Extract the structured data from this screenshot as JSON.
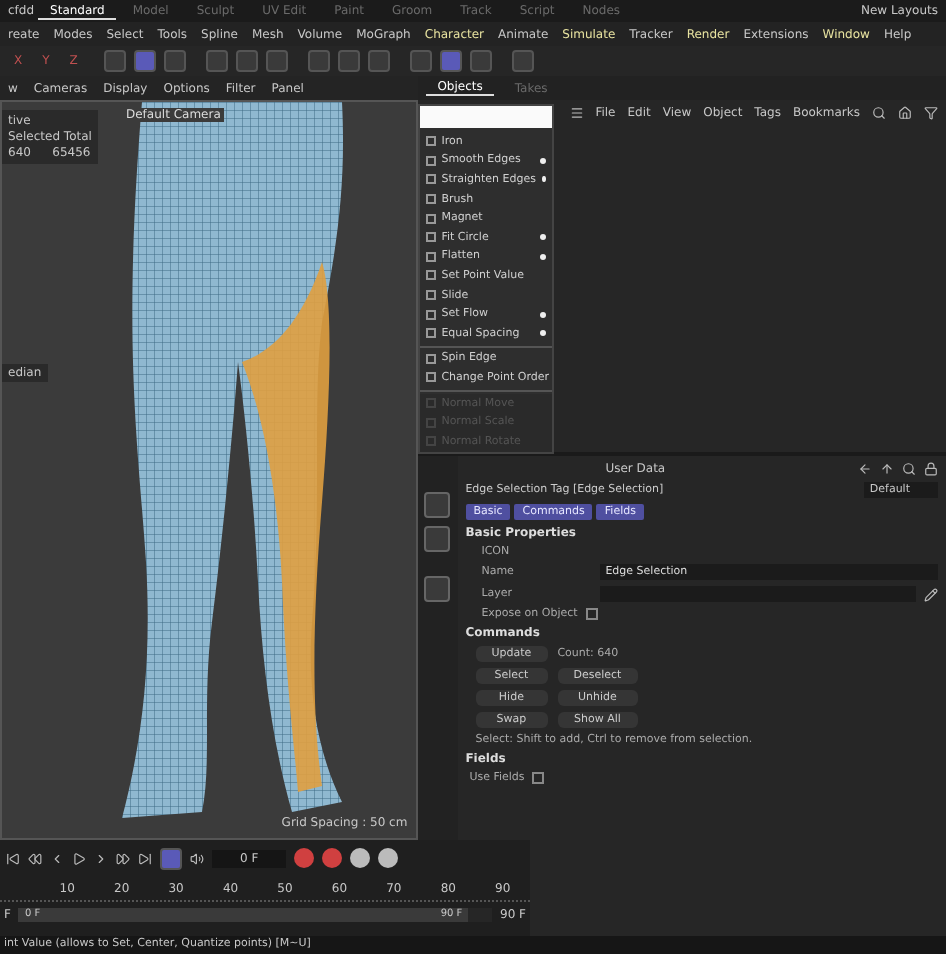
{
  "layout_tabs": {
    "file": "cfdd",
    "items": [
      {
        "label": "Standard",
        "selected": true
      },
      {
        "label": "Model",
        "selected": false
      },
      {
        "label": "Sculpt",
        "selected": false
      },
      {
        "label": "UV Edit",
        "selected": false
      },
      {
        "label": "Paint",
        "selected": false
      },
      {
        "label": "Groom",
        "selected": false
      },
      {
        "label": "Track",
        "selected": false
      },
      {
        "label": "Script",
        "selected": false
      },
      {
        "label": "Nodes",
        "selected": false
      }
    ],
    "new_layouts": "New Layouts"
  },
  "menu": [
    "reate",
    "Modes",
    "Select",
    "Tools",
    "Spline",
    "Mesh",
    "Volume",
    "MoGraph",
    "Character",
    "Animate",
    "Simulate",
    "Tracker",
    "Render",
    "Extensions",
    "Window",
    "Help"
  ],
  "toolbar": {
    "axes": [
      "X",
      "Y",
      "Z"
    ],
    "tools": [
      {
        "selected": false
      },
      {
        "selected": true
      },
      {
        "selected": false
      },
      {
        "selected": false
      },
      {
        "selected": false
      },
      {
        "selected": false
      },
      {
        "selected": false
      },
      {
        "selected": false
      },
      {
        "selected": false
      },
      {
        "selected": false
      },
      {
        "selected": true
      },
      {
        "selected": false
      },
      {
        "selected": false
      }
    ]
  },
  "viewport": {
    "menu": [
      "w",
      "Cameras",
      "Display",
      "Options",
      "Filter",
      "Panel"
    ],
    "camera": "Default Camera",
    "info": {
      "mode": "tive",
      "heading": "Selected Total",
      "selected": "640",
      "total": "65456"
    },
    "pivot": "edian",
    "grid": "Grid Spacing : 50 cm"
  },
  "objects_panel": {
    "tabs": [
      {
        "label": "Objects",
        "selected": true
      },
      {
        "label": "Takes",
        "selected": false
      }
    ],
    "menu": [
      "File",
      "Edit",
      "View",
      "Object",
      "Tags",
      "Bookmarks"
    ]
  },
  "popup_menu": [
    {
      "label": "Iron",
      "kind": "item",
      "dot": false
    },
    {
      "label": "Smooth Edges",
      "kind": "item",
      "dot": true
    },
    {
      "label": "Straighten Edges",
      "kind": "item",
      "dot": true
    },
    {
      "label": "Brush",
      "kind": "item",
      "dot": false
    },
    {
      "label": "Magnet",
      "kind": "item",
      "dot": false
    },
    {
      "label": "Fit Circle",
      "kind": "item",
      "dot": true
    },
    {
      "label": "Flatten",
      "kind": "item",
      "dot": true
    },
    {
      "label": "Set Point Value",
      "kind": "item",
      "dot": false
    },
    {
      "label": "Slide",
      "kind": "item",
      "dot": false
    },
    {
      "label": "Set Flow",
      "kind": "item",
      "dot": true
    },
    {
      "label": "Equal Spacing",
      "kind": "item",
      "dot": true
    },
    {
      "kind": "divider"
    },
    {
      "label": "Spin Edge",
      "kind": "item",
      "dot": false
    },
    {
      "label": "Change Point Order",
      "kind": "item",
      "dot": false
    },
    {
      "kind": "divider"
    },
    {
      "label": "Normal Move",
      "kind": "disabled",
      "dot": false
    },
    {
      "label": "Normal Scale",
      "kind": "disabled",
      "dot": false
    },
    {
      "label": "Normal Rotate",
      "kind": "disabled",
      "dot": false
    }
  ],
  "attributes": {
    "header": "User Data",
    "title": "Edge Selection Tag [Edge Selection]",
    "preset": "Default",
    "tabs": [
      {
        "label": "Basic",
        "selected": true
      },
      {
        "label": "Commands",
        "selected": true
      },
      {
        "label": "Fields",
        "selected": true
      }
    ],
    "basic_heading": "Basic Properties",
    "icon_row": "ICON",
    "name_label": "Name",
    "name_value": "Edge Selection",
    "layer_label": "Layer",
    "expose_label": "Expose on Object",
    "expose_checked": false,
    "commands_heading": "Commands",
    "count": "Count: 640",
    "buttons": [
      [
        "Update"
      ],
      [
        "Select",
        "Deselect"
      ],
      [
        "Hide",
        "Unhide"
      ],
      [
        "Swap",
        "Show All"
      ]
    ],
    "hint": "Select: Shift to add, Ctrl to remove from selection.",
    "fields_heading": "Fields",
    "use_fields_label": "Use Fields",
    "use_fields_checked": false
  },
  "timeline": {
    "frame": "0 F",
    "ticks": [
      "10",
      "20",
      "30",
      "40",
      "50",
      "60",
      "70",
      "80",
      "90"
    ],
    "start": "F",
    "range": {
      "level": 0.95,
      "start": "0 F",
      "end": "90 F"
    },
    "end": "90 F"
  },
  "status": "int Value (allows to Set, Center, Quantize points) [M~U]"
}
